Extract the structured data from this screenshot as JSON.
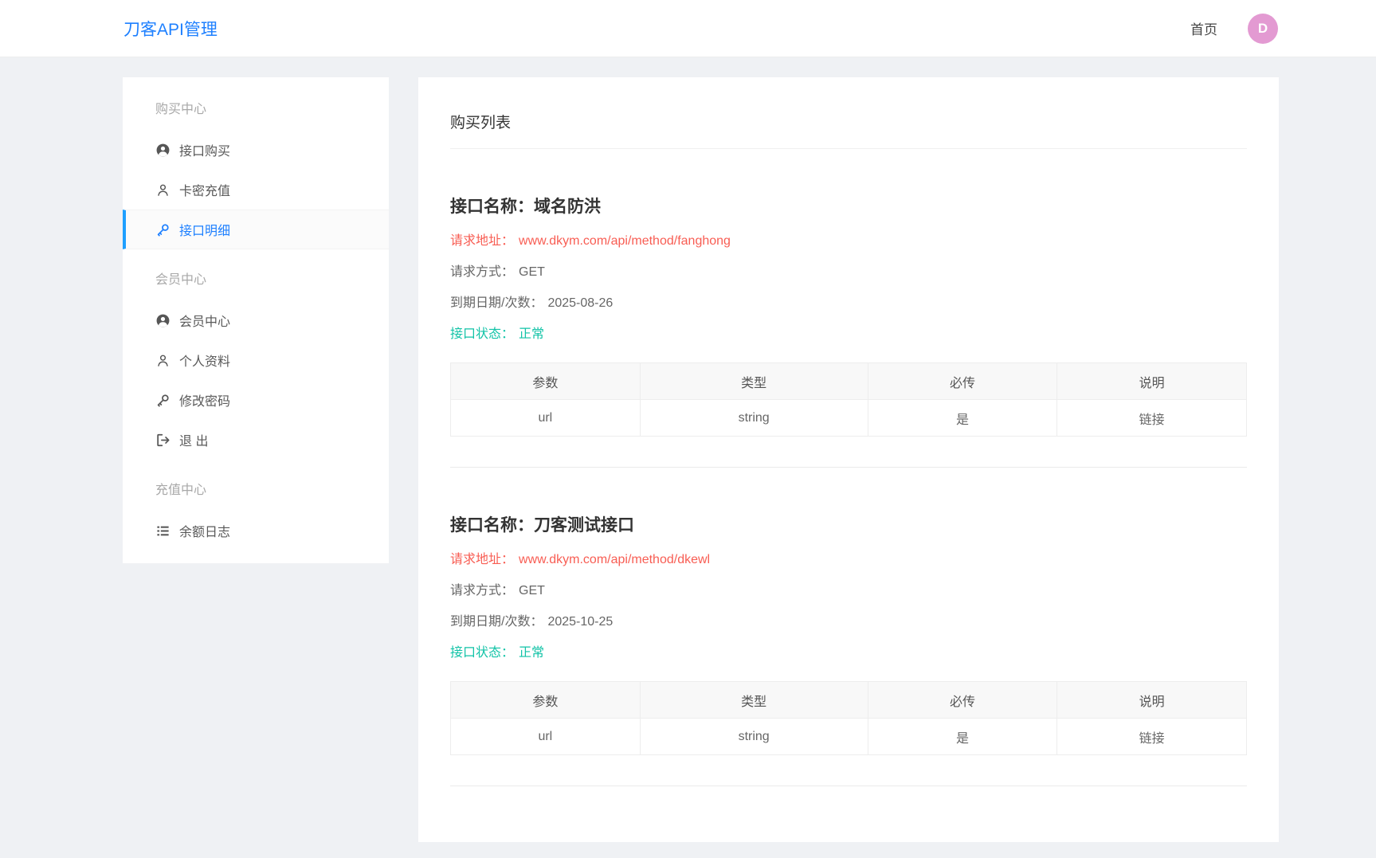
{
  "header": {
    "brand": "刀客API管理",
    "nav": [
      {
        "label": "首页"
      }
    ],
    "avatar": {
      "letter": "D"
    }
  },
  "sidebar": {
    "sections": [
      {
        "label": "购买中心",
        "items": [
          {
            "label": "接口购买",
            "icon": "user-circle-icon",
            "active": false
          },
          {
            "label": "卡密充值",
            "icon": "user-icon",
            "active": false
          },
          {
            "label": "接口明细",
            "icon": "key-icon",
            "active": true
          }
        ]
      },
      {
        "label": "会员中心",
        "items": [
          {
            "label": "会员中心",
            "icon": "user-circle-icon",
            "active": false
          },
          {
            "label": "个人资料",
            "icon": "user-icon",
            "active": false
          },
          {
            "label": "修改密码",
            "icon": "key-icon",
            "active": false
          },
          {
            "label": "退 出",
            "icon": "sign-out-icon",
            "active": false
          }
        ]
      },
      {
        "label": "充值中心",
        "items": [
          {
            "label": "余额日志",
            "icon": "list-icon",
            "active": false
          }
        ]
      }
    ]
  },
  "main": {
    "title": "购买列表",
    "apis": [
      {
        "name_label": "接口名称：",
        "name": "域名防洪",
        "url_label": "请求地址：",
        "url": "www.dkym.com/api/method/fanghong",
        "method_label": "请求方式：",
        "method": "GET",
        "expire_label": "到期日期/次数：",
        "expire": "2025-08-26",
        "status_label": "接口状态：",
        "status": "正常",
        "table": {
          "headers": [
            "参数",
            "类型",
            "必传",
            "说明"
          ],
          "rows": [
            [
              "url",
              "string",
              "是",
              "链接"
            ]
          ]
        }
      },
      {
        "name_label": "接口名称：",
        "name": "刀客测试接口",
        "url_label": "请求地址：",
        "url": "www.dkym.com/api/method/dkewl",
        "method_label": "请求方式：",
        "method": "GET",
        "expire_label": "到期日期/次数：",
        "expire": "2025-10-25",
        "status_label": "接口状态：",
        "status": "正常",
        "table": {
          "headers": [
            "参数",
            "类型",
            "必传",
            "说明"
          ],
          "rows": [
            [
              "url",
              "string",
              "是",
              "链接"
            ]
          ]
        }
      }
    ]
  },
  "colors": {
    "accent_blue": "#1e80ff",
    "danger_red": "#f85d53",
    "success_teal": "#12c3a7",
    "avatar_pink": "#e39ad2"
  }
}
